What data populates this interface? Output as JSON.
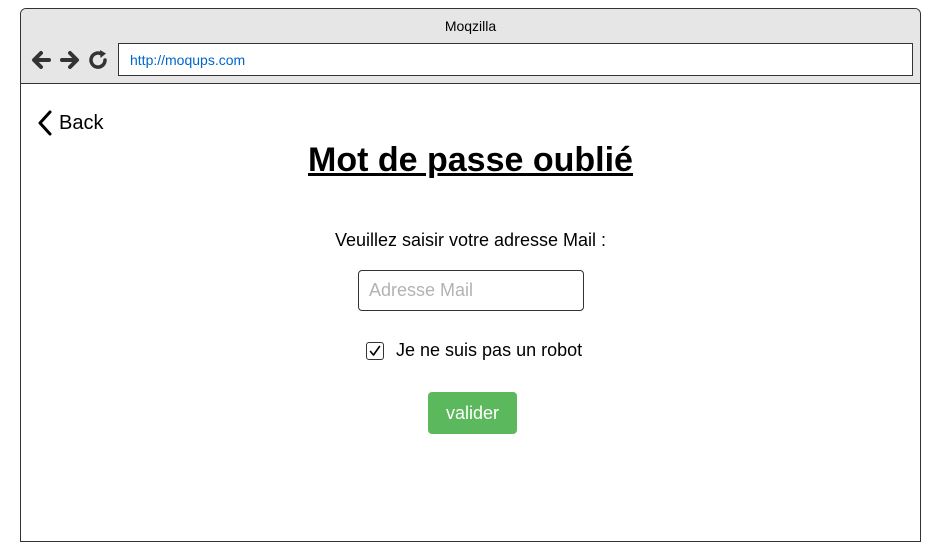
{
  "browser": {
    "window_title": "Moqzilla",
    "address_url": "http://moqups.com",
    "nav_icons": [
      "back-arrow-icon",
      "forward-arrow-icon",
      "reload-icon"
    ]
  },
  "page": {
    "back_label": "Back",
    "title": "Mot de passe oublié",
    "prompt": "Veuillez saisir votre adresse Mail :",
    "email_placeholder": "Adresse Mail",
    "email_value": "",
    "robot_label": "Je ne suis pas un robot",
    "robot_checked": true,
    "submit_label": "valider"
  },
  "colors": {
    "chrome_bg": "#e6e6e6",
    "url_text": "#0066cc",
    "button_bg": "#5cb85c",
    "button_text": "#ffffff",
    "placeholder": "#b3b3b3"
  }
}
